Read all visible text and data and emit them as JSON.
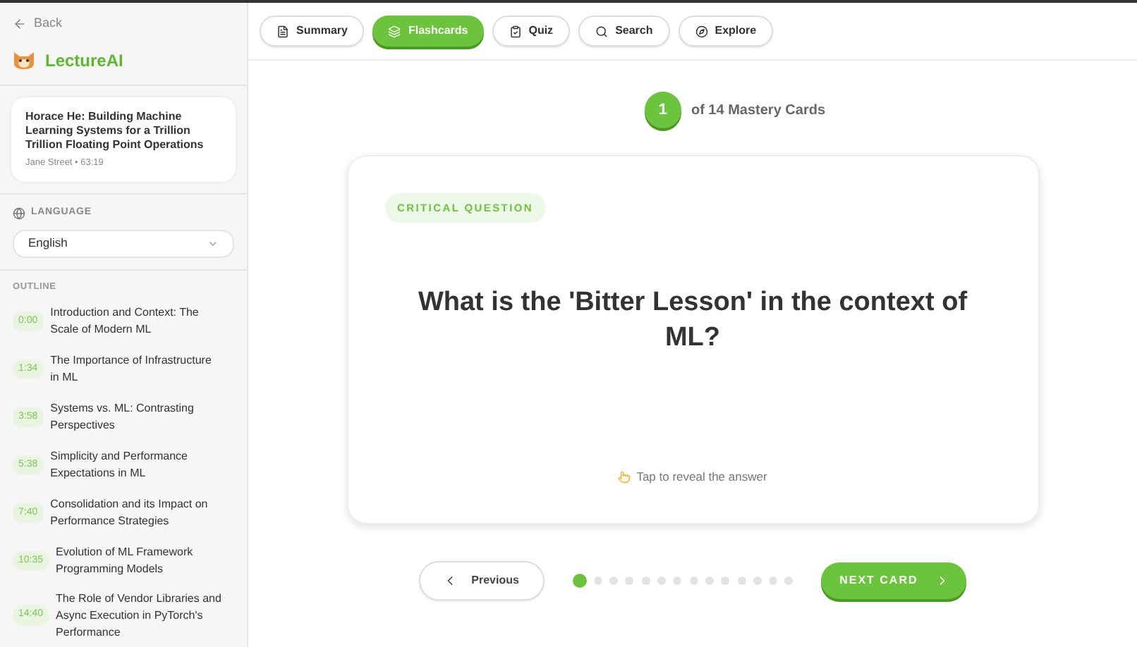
{
  "sidebar": {
    "back": "Back",
    "brand": "LectureAI",
    "video": {
      "title": "Horace He: Building Machine Learning Systems for a Trillion Trillion Floating Point Operations",
      "meta": "Jane Street • 63:19"
    },
    "language": {
      "label": "LANGUAGE",
      "value": "English"
    },
    "outline": {
      "label": "OUTLINE",
      "items": [
        {
          "time": "0:00",
          "title": "Introduction and Context: The Scale of Modern ML"
        },
        {
          "time": "1:34",
          "title": "The Importance of Infrastructure in ML"
        },
        {
          "time": "3:58",
          "title": "Systems vs. ML: Contrasting Perspectives"
        },
        {
          "time": "5:38",
          "title": "Simplicity and Performance Expectations in ML"
        },
        {
          "time": "7:40",
          "title": "Consolidation and its Impact on Performance Strategies"
        },
        {
          "time": "10:35",
          "title": "Evolution of ML Framework Programming Models"
        },
        {
          "time": "14:40",
          "title": "The Role of Vendor Libraries and Async Execution in PyTorch's Performance"
        }
      ]
    }
  },
  "tabs": [
    {
      "label": "Summary",
      "kind": "summary",
      "selected": false
    },
    {
      "label": "Flashcards",
      "kind": "flashcards",
      "selected": true
    },
    {
      "label": "Quiz",
      "kind": "quiz",
      "selected": false
    },
    {
      "label": "Search",
      "kind": "search",
      "selected": false
    },
    {
      "label": "Explore",
      "kind": "explore",
      "selected": false
    }
  ],
  "progress": {
    "current": "1",
    "total_text": "of 14 Mastery Cards"
  },
  "card": {
    "tag": "CRITICAL QUESTION",
    "question": "What is the 'Bitter Lesson' in the context of ML?",
    "hint": "Tap to reveal the answer"
  },
  "nav": {
    "previous": "Previous",
    "next": "NEXT CARD",
    "dots": [
      {
        "selected": true
      },
      {
        "selected": false
      },
      {
        "selected": false
      },
      {
        "selected": false
      },
      {
        "selected": false
      },
      {
        "selected": false
      },
      {
        "selected": false
      },
      {
        "selected": false
      },
      {
        "selected": false
      },
      {
        "selected": false
      },
      {
        "selected": false
      },
      {
        "selected": false
      },
      {
        "selected": false
      },
      {
        "selected": false
      }
    ]
  }
}
